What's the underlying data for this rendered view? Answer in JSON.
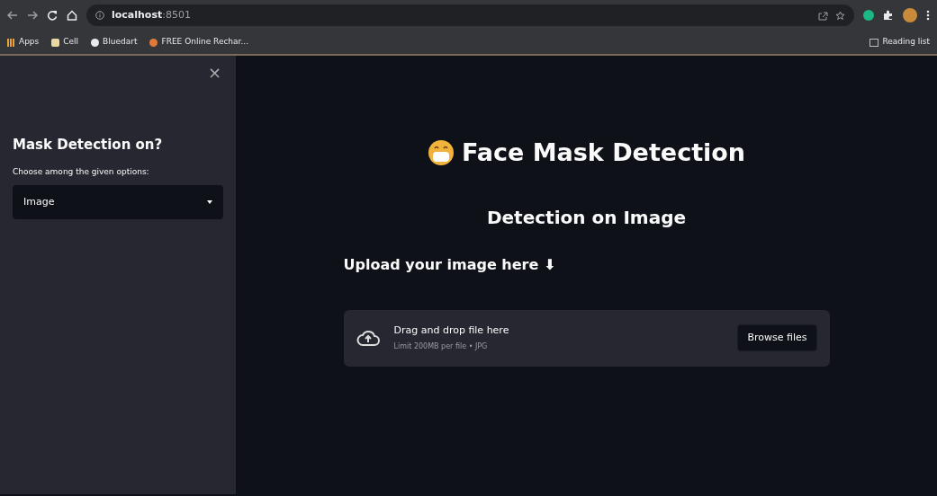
{
  "browser": {
    "url_host": "localhost",
    "url_port": ":8501",
    "bookmarks": [
      {
        "label": "Apps",
        "kind": "grid"
      },
      {
        "label": "Cell",
        "kind": "square"
      },
      {
        "label": "Bluedart",
        "kind": "globe"
      },
      {
        "label": "FREE Online Rechar...",
        "kind": "orange"
      }
    ],
    "reading_list": "Reading list"
  },
  "sidebar": {
    "close": "×",
    "heading": "Mask Detection on?",
    "select": {
      "label": "Choose among the given options:",
      "value": "Image"
    }
  },
  "main": {
    "title": "Face Mask Detection",
    "subtitle": "Detection on Image",
    "upload_heading": "Upload your image here ⬇",
    "uploader": {
      "prompt": "Drag and drop file here",
      "limit": "Limit 200MB per file • JPG",
      "button": "Browse files"
    }
  }
}
